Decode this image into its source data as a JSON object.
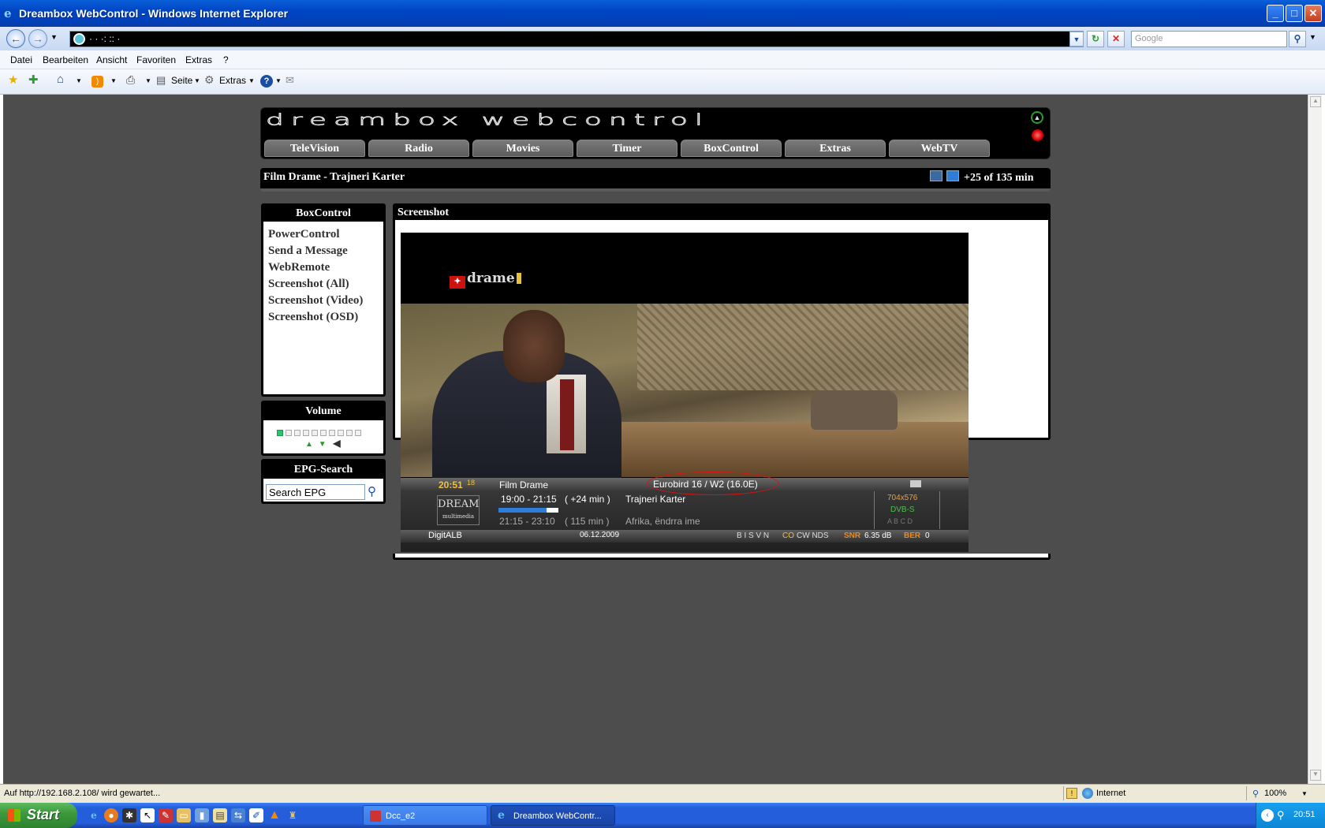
{
  "window": {
    "title": "Dreambox WebControl - Windows Internet Explorer",
    "ie_icon": "e"
  },
  "addressbar": {
    "url": "·  ·  ·:  ::  ·",
    "search_placeholder": "Google"
  },
  "menu": [
    "Datei",
    "Bearbeiten",
    "Ansicht",
    "Favoriten",
    "Extras",
    "?"
  ],
  "toolbar": {
    "page_label": "Seite",
    "extras_label": "Extras"
  },
  "dreambox": {
    "nav_tabs": [
      "TeleVision",
      "Radio",
      "Movies",
      "Timer",
      "BoxControl",
      "Extras",
      "WebTV"
    ],
    "current_event": "Film Drame - Trajneri Karter",
    "current_progress": "+25 of 135 min",
    "sidebar": {
      "title": "BoxControl",
      "links": [
        "PowerControl",
        "Send a Message",
        "WebRemote",
        "Screenshot (All)",
        "Screenshot (Video)",
        "Screenshot (OSD)"
      ]
    },
    "volume": {
      "title": "Volume",
      "level": 1,
      "segments": 10
    },
    "epg": {
      "title": "EPG-Search",
      "placeholder": "Search EPG"
    },
    "main": {
      "title": "Screenshot"
    }
  },
  "tv": {
    "channel_logo": "drame",
    "osd": {
      "time": "20:51",
      "seconds": "18",
      "channel": "Film Drame",
      "satellite": "Eurobird 16 / W2 (16.0E)",
      "now_time": "19:00 - 21:15",
      "now_remaining": "( +24 min )",
      "now_title": "Trajneri Karter",
      "next_time": "21:15 - 23:10",
      "next_duration": "( 115 min )",
      "next_title": "Afrika, ëndrra ime",
      "resolution": "704x576",
      "system": "DVB-S",
      "tracks": "A  B  C  D",
      "provider": "DigitALB",
      "date": "06.12.2009",
      "ca": "B I S V N",
      "ca_co": "CO",
      "ca_rest": "CW NDS",
      "snr_label": "SNR",
      "snr_value": "6.35 dB",
      "ber_label": "BER",
      "ber_value": "0",
      "logo_text": "DREAM",
      "logo_sub": "multimedia",
      "progress": 0.8
    }
  },
  "statusbar": {
    "text": "Auf http://192.168.2.108/ wird gewartet...",
    "zone": "Internet",
    "zoom": "100%"
  },
  "taskbar": {
    "start": "Start",
    "tasks": [
      "Dcc_e2",
      "Dreambox WebContr..."
    ],
    "clock": "20:51"
  }
}
